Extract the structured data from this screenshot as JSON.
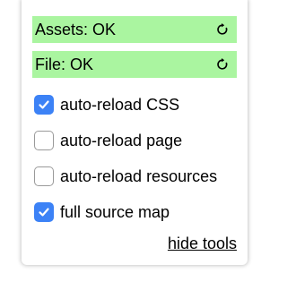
{
  "colors": {
    "status_ok_bg": "#aaf5a0",
    "checkbox_checked": "#3c82f6"
  },
  "status": [
    {
      "label": "Assets: OK",
      "icon": "reload-icon"
    },
    {
      "label": "File: OK",
      "icon": "reload-icon"
    }
  ],
  "options": [
    {
      "label": "auto-reload CSS",
      "checked": true
    },
    {
      "label": "auto-reload page",
      "checked": false
    },
    {
      "label": "auto-reload resources",
      "checked": false
    },
    {
      "label": "full source map",
      "checked": true
    }
  ],
  "hide_link": "hide tools"
}
